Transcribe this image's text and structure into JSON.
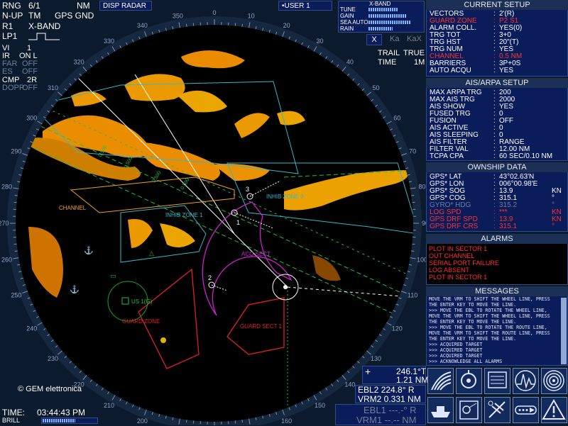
{
  "top_left": {
    "rng_label": "RNG",
    "rng_value": "6/1",
    "rng_unit": "NM",
    "orientation": "N-UP",
    "motion": "TM",
    "speed_ref": "GPS GND",
    "radar_sel": "R1",
    "band": "X-BAND",
    "pulse": "LP1",
    "vi_label": "VI",
    "vi_value": "1",
    "ir_label": "IR",
    "ir_value": "ON L",
    "far_label": "FAR",
    "far_value": "OFF",
    "es_label": "ES",
    "es_value": "OFF",
    "cmp_label": "CMP",
    "cmp_value": "2R",
    "dopp_label": "DOPP",
    "dopp_value": "OFF"
  },
  "disp_radar": "DISP RADAR",
  "user": "•USER 1",
  "tune_box": {
    "title": "X-BAND",
    "rows": [
      {
        "label": "TUNE",
        "level": 0.55
      },
      {
        "label": "GAIN",
        "level": 0.7
      },
      {
        "label": "SEA AUTO",
        "level": 0.8
      },
      {
        "label": "RAIN",
        "level": 0.45
      }
    ],
    "btn_x": "X",
    "btn_ka": "Ka",
    "btn_kax": "KaX"
  },
  "trail": {
    "trail_label": "TRAIL",
    "trail_value": "TRUE",
    "time_label": "TIME",
    "time_value": "1M"
  },
  "current_setup": {
    "title": "CURRENT SETUP",
    "rows": [
      {
        "k": "VECTORS",
        "v": "2'(R)",
        "red": false
      },
      {
        "k": "GUARD ZONE",
        "v": "P2 S1",
        "red": true
      },
      {
        "k": "ALARM COLL.",
        "v": "YES(0)",
        "red": false
      },
      {
        "k": "TRG TOT",
        "v": "3+0",
        "red": false
      },
      {
        "k": "TRG HST",
        "v": "20\"(T)",
        "red": false
      },
      {
        "k": "TRG NUM",
        "v": "YES",
        "red": false
      },
      {
        "k": "CHANNEL",
        "v": "0.5 NM",
        "red": true
      },
      {
        "k": "BARRIERS",
        "v": "3P+0S",
        "red": false
      },
      {
        "k": "AUTO ACQU",
        "v": "YES",
        "red": false
      }
    ]
  },
  "ais_arpa": {
    "title": "AIS/ARPA SETUP",
    "rows": [
      {
        "k": "MAX ARPA TRG",
        "v": "200"
      },
      {
        "k": "MAX AIS TRG",
        "v": "2000"
      },
      {
        "k": "AIS SHOW",
        "v": "YES"
      },
      {
        "k": "FUSED TRG",
        "v": "0"
      },
      {
        "k": "FUSION",
        "v": "OFF"
      },
      {
        "k": "AIS ACTIVE",
        "v": "0"
      },
      {
        "k": "AIS SLEEPING",
        "v": "0"
      },
      {
        "k": "AIS FILTER",
        "v": "RANGE"
      },
      {
        "k": "FILTER VAL",
        "v": "12.00 NM"
      },
      {
        "k": "TCPA CPA",
        "v": "60 SEC/0.10 NM"
      }
    ]
  },
  "ownship": {
    "title": "OWNSHIP DATA",
    "rows": [
      {
        "k": "GPS* LAT",
        "v": "43°02.63'N",
        "u": "",
        "style": "white"
      },
      {
        "k": "GPS* LON",
        "v": "006°00.98'E",
        "u": "",
        "style": "white"
      },
      {
        "k": "GPS* SOG",
        "v": "13.9",
        "u": "KN",
        "style": "white"
      },
      {
        "k": "GPS* COG",
        "v": "315.1",
        "u": "°",
        "style": "white"
      },
      {
        "k": "GYRO* HDG",
        "v": "315.2",
        "u": "°",
        "style": "dim"
      },
      {
        "k": "LOG  SPD",
        "v": "***",
        "u": "KN",
        "style": "red"
      },
      {
        "k": "GPS DRF SPD",
        "v": "13.9",
        "u": "KN",
        "style": "red"
      },
      {
        "k": "GPS DRF CRS",
        "v": "315.1",
        "u": "°",
        "style": "red"
      }
    ]
  },
  "alarms": {
    "title": "ALARMS",
    "items": [
      "PLOT IN SECTOR 1",
      "OUT CHANNEL",
      "SERIAL PORT FAILURE",
      "LOG ABSENT",
      "PLOT IN SECTOR 1"
    ]
  },
  "messages": {
    "title": "MESSAGES",
    "lines": [
      "MOVE THE VRM TO SHIFT THE WHEEL LINE, PRESS",
      "THE ENTER KEY TO MOVE THE LINE.",
      ">>> MOVE THE EBL TO ROTATE THE WHEEL LINE,",
      "MOVE THE VRM TO SHIFT THE WHEEL LINE, PRESS",
      "THE ENTER KEY TO MOVE THE LINE.",
      ">>> MOVE THE EBL TO ROTATE THE ROUTE LINE,",
      "MOVE THE VRM TO SHIFT THE ROUTE LINE, PRESS",
      "THE ENTER KEY TO MOVE THE LINE.",
      ">>> ACQUIRED TARGET",
      ">>> ACQUIRED TARGET",
      ">>> ACQUIRED TARGET",
      ">>> ACKNOWLEDGE ALL ALARMS",
      ">>> ACQUIRED TARGET"
    ]
  },
  "cursor_readout": {
    "bearing": "246.1°T",
    "range": "1.21 NM"
  },
  "ebl2": "EBL2 224.8° R",
  "vrm2": "VRM2 0.331 NM",
  "ebl1": "EBL1 ---.-° R",
  "vrm1": "VRM1 --.-- NM",
  "time_label": "TIME:",
  "time_value": "03:44:43 PM",
  "brill_label": "BRILL",
  "brill_level": 0.6,
  "copyright": "© GEM elettronica",
  "zone_labels": {
    "channel": "CHANNEL",
    "inhib1": "INHIB ZONE 1",
    "inhib3": "INHIB ZONE 3",
    "acq": "ACQ SECT",
    "guard": "GUARD ZONE",
    "guard_sect": "GUARD SECT 1",
    "us": "US 1(G)",
    "t1": "1",
    "t2": "2",
    "t3": "3"
  },
  "ring_labels": [
    "340",
    "350",
    "0",
    "10",
    "20",
    "30",
    "40",
    "50",
    "60",
    "70",
    "80",
    "90",
    "100",
    "110",
    "120",
    "130",
    "140",
    "150",
    "160",
    "170",
    "180",
    "190",
    "200",
    "210",
    "220",
    "230",
    "240",
    "250",
    "260",
    "270",
    "280",
    "290",
    "300",
    "310",
    "320",
    "330"
  ],
  "channel_distances": [
    "0.500",
    "0.500",
    "0.500",
    "0.500"
  ],
  "icons": [
    "sea-clutter-icon",
    "ownship-icon",
    "menu-list-icon",
    "waveform-icon",
    "rings-icon",
    "ship-icon",
    "target-icon",
    "plane-map-icon",
    "trail-icon",
    "warning-icon"
  ],
  "colors": {
    "echo": "#ffb000",
    "zone_cyan": "#37b7c9",
    "zone_orange": "#f0a020",
    "zone_magenta": "#d020d0",
    "zone_red": "#e02020",
    "panel": "#0a1d5a"
  }
}
